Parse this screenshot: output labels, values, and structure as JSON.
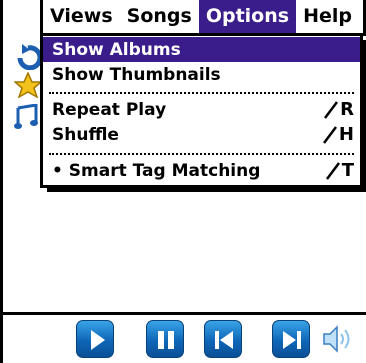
{
  "menubar": {
    "menus": [
      {
        "label": "Views"
      },
      {
        "label": "Songs"
      },
      {
        "label": "Options"
      },
      {
        "label": "Help"
      }
    ]
  },
  "options_menu": {
    "items": [
      {
        "label": "Show Albums",
        "shortcut": ""
      },
      {
        "label": "Show Thumbnails",
        "shortcut": ""
      },
      {
        "label": "Repeat Play",
        "shortcut": "R"
      },
      {
        "label": "Shuffle",
        "shortcut": "H"
      },
      {
        "label": "• Smart Tag Matching",
        "shortcut": "T"
      }
    ]
  },
  "colors": {
    "highlight": "#3a1c8a",
    "button_blue": "#1a73c9"
  },
  "icons": {
    "background_sidebar": [
      "refresh-icon",
      "star-icon",
      "music-note-icon"
    ],
    "controls": [
      "play-icon",
      "pause-icon",
      "previous-track-icon",
      "next-track-icon",
      "volume-icon"
    ]
  }
}
